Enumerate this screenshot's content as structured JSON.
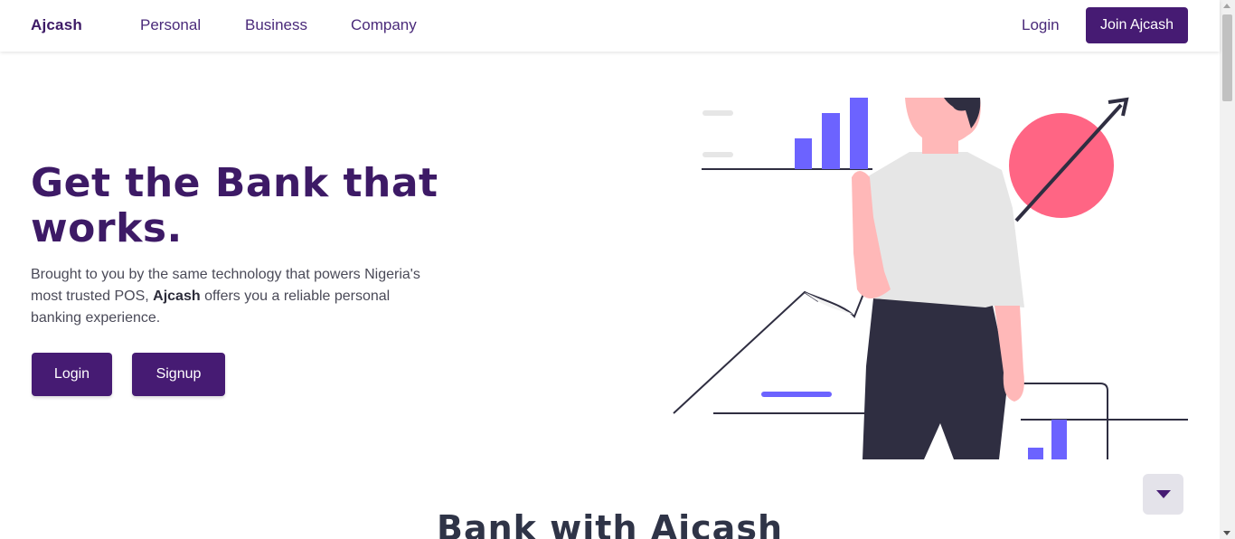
{
  "nav": {
    "brand": "Ajcash",
    "links": [
      "Personal",
      "Business",
      "Company"
    ],
    "login": "Login",
    "join": "Join Ajcash"
  },
  "hero": {
    "title": "Get the Bank that works.",
    "text_before": "Brought to you by the same technology that powers Nigeria's most trusted POS, ",
    "text_bold": "Ajcash",
    "text_after": " offers you a reliable personal banking experience.",
    "login_button": "Login",
    "signup_button": "Signup"
  },
  "section": {
    "title": "Bank with Ajcash"
  },
  "colors": {
    "brand": "#461b73",
    "accent_bars": "#6c63ff",
    "circle": "#ff6584",
    "dark": "#2f2e41",
    "skin": "#ffb8b8"
  },
  "icons": {
    "scroll_down": "triangle-down-icon"
  }
}
